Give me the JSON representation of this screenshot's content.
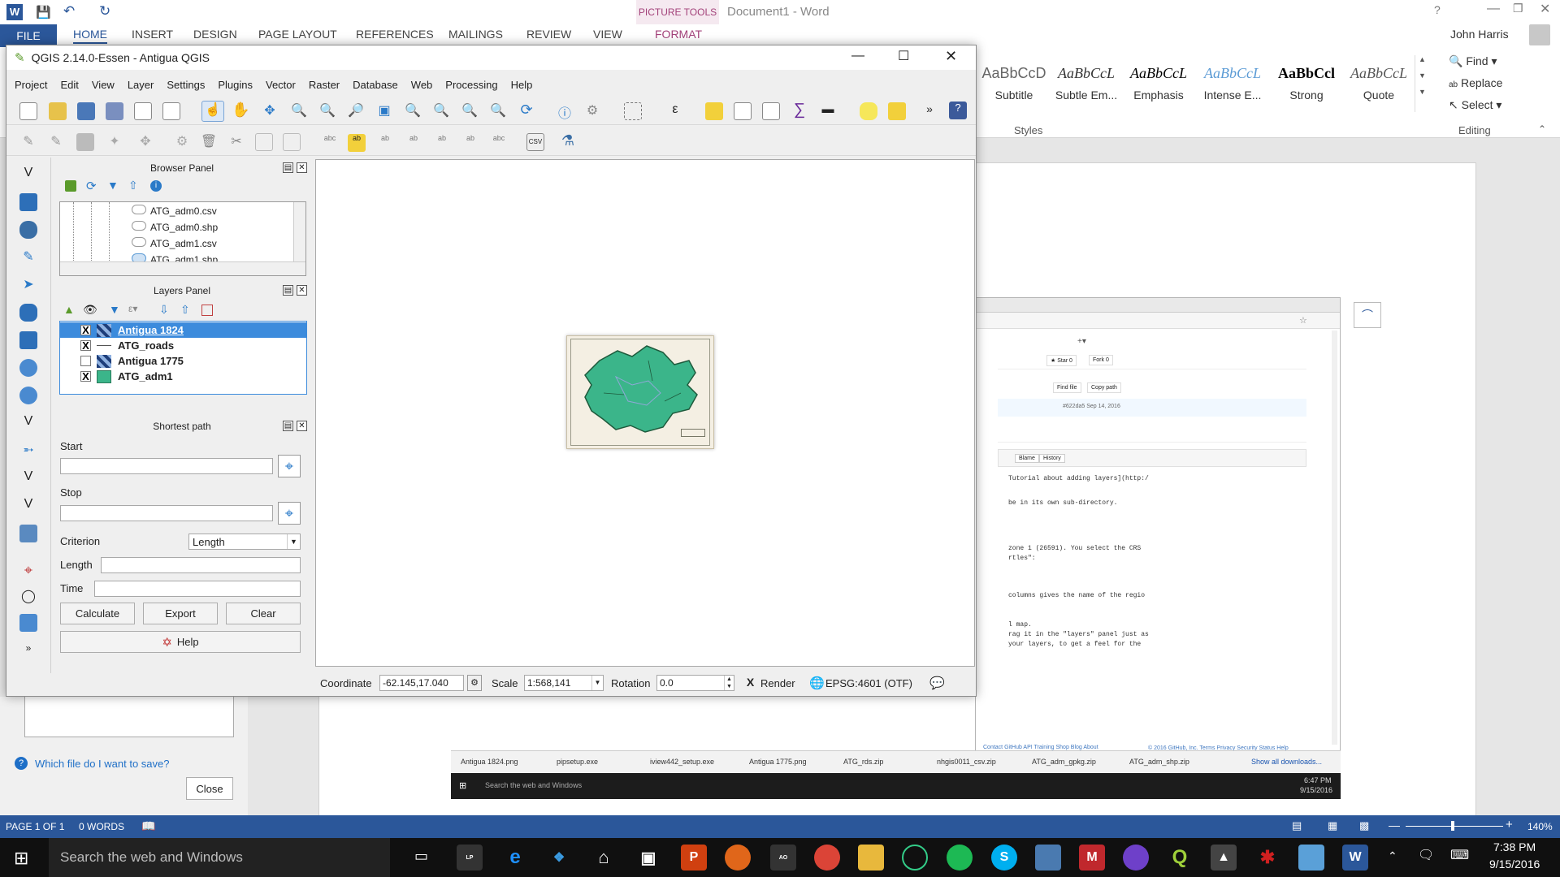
{
  "word": {
    "title": "Document1 - Word",
    "context_tab": "PICTURE TOOLS",
    "file_tab": "FILE",
    "tabs": [
      "HOME",
      "INSERT",
      "DESIGN",
      "PAGE LAYOUT",
      "REFERENCES",
      "MAILINGS",
      "REVIEW",
      "VIEW",
      "FORMAT"
    ],
    "user": "John Harris",
    "styles": [
      {
        "sample": "AaBbCcD",
        "name": "Subtitle"
      },
      {
        "sample": "AaBbCcL",
        "name": "Subtle Em..."
      },
      {
        "sample": "AaBbCcL",
        "name": "Emphasis"
      },
      {
        "sample": "AaBbCcL",
        "name": "Intense E..."
      },
      {
        "sample": "AaBbCcl",
        "name": "Strong"
      },
      {
        "sample": "AaBbCcL",
        "name": "Quote"
      }
    ],
    "styles_group": "Styles",
    "editing": {
      "find": "Find",
      "replace": "Replace",
      "select": "Select",
      "group": "Editing"
    },
    "dialog": {
      "help_link": "Which file do I want to save?",
      "close": "Close"
    },
    "status": {
      "page": "PAGE 1 OF 1",
      "words": "0 WORDS",
      "zoom": "140%"
    }
  },
  "qgis": {
    "title": "QGIS 2.14.0-Essen - Antigua QGIS",
    "menu": [
      "Project",
      "Edit",
      "View",
      "Layer",
      "Settings",
      "Plugins",
      "Vector",
      "Raster",
      "Database",
      "Web",
      "Processing",
      "Help"
    ],
    "browser_panel": {
      "title": "Browser Panel",
      "files": [
        "ATG_adm0.csv",
        "ATG_adm0.shp",
        "ATG_adm1.csv",
        "ATG_adm1.shp"
      ]
    },
    "layers_panel": {
      "title": "Layers Panel",
      "layers": [
        {
          "name": "Antigua 1824",
          "checked": "X",
          "selected": true
        },
        {
          "name": "ATG_roads",
          "checked": "X",
          "selected": false
        },
        {
          "name": "Antigua 1775",
          "checked": "",
          "selected": false
        },
        {
          "name": "ATG_adm1",
          "checked": "X",
          "selected": false
        }
      ]
    },
    "shortest_path": {
      "title": "Shortest path",
      "start_label": "Start",
      "stop_label": "Stop",
      "criterion_label": "Criterion",
      "criterion_value": "Length",
      "length_label": "Length",
      "time_label": "Time",
      "calculate": "Calculate",
      "export": "Export",
      "clear": "Clear",
      "help": "Help"
    },
    "status": {
      "coordinate_label": "Coordinate",
      "coordinate_value": "-62.145,17.040",
      "scale_label": "Scale",
      "scale_value": "1:568,141",
      "rotation_label": "Rotation",
      "rotation_value": "0.0",
      "render_label": "Render",
      "render_checked": "X",
      "crs": "EPSG:4601 (OTF)"
    }
  },
  "browser": {
    "buttons": [
      "Star",
      "Fork",
      "Find file",
      "Copy path",
      "Blame",
      "History"
    ],
    "commit": "#622da5 Sep 14, 2016",
    "lines": [
      "Tutorial about adding layers](http:/",
      "be in its own sub-directory.",
      "zone 1 (26591). You select the CRS",
      "rtles\":",
      "columns gives the name of the regio",
      "l map.",
      "rag it in the \"layers\" panel just as",
      "your layers, to get a feel for the"
    ],
    "footer": "© 2016 GitHub, Inc.   Terms   Privacy   Security   Status   Help",
    "footer_right": "Contact GitHub   API   Training   Shop   Blog   About",
    "downloads": [
      "Antigua 1824.png",
      "pipsetup.exe",
      "iview442_setup.exe",
      "Antigua 1775.png",
      "ATG_rds.zip",
      "nhgis0011_csv.zip",
      "ATG_adm_gpkg.zip",
      "ATG_adm_shp.zip"
    ],
    "show_all": "Show all downloads...",
    "mini_search": "Search the web and Windows",
    "mini_time": "6:47 PM",
    "mini_date": "9/15/2016"
  },
  "taskbar": {
    "search": "Search the web and Windows",
    "time": "7:38 PM",
    "date": "9/15/2016"
  },
  "colors": {
    "word_blue": "#2b579a",
    "selection": "#3c8bdc",
    "map_green": "#3bb58a",
    "taskbar": "#101010"
  }
}
